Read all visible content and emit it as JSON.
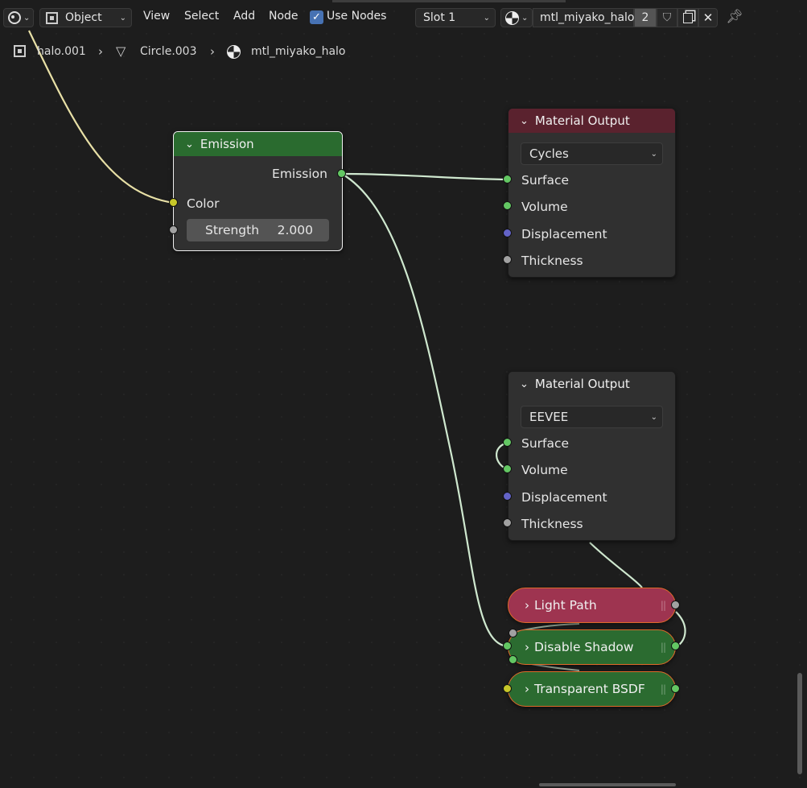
{
  "header": {
    "mode": "Object",
    "menus": [
      "View",
      "Select",
      "Add",
      "Node"
    ],
    "use_nodes_label": "Use Nodes",
    "use_nodes_checked": true,
    "slot": "Slot 1",
    "material_name": "mtl_miyako_halo",
    "user_count": "2",
    "icons": [
      "editor-type-icon",
      "object-mode-icon",
      "material-sphere-icon",
      "fake-user-shield-icon",
      "duplicate-icon",
      "close-icon",
      "pin-icon"
    ]
  },
  "breadcrumb": {
    "object": "halo.001",
    "mesh": "Circle.003",
    "material": "mtl_miyako_halo"
  },
  "nodes": {
    "emission": {
      "title": "Emission",
      "output": "Emission",
      "input_color": "Color",
      "strength_label": "Strength",
      "strength_value": "2.000"
    },
    "output_cycles": {
      "title": "Material Output",
      "target": "Cycles",
      "inputs": [
        "Surface",
        "Volume",
        "Displacement",
        "Thickness"
      ]
    },
    "output_eevee": {
      "title": "Material Output",
      "target": "EEVEE",
      "inputs": [
        "Surface",
        "Volume",
        "Displacement",
        "Thickness"
      ]
    },
    "light_path": {
      "title": "Light Path"
    },
    "disable_shadow": {
      "title": "Disable Shadow"
    },
    "transparent_bsdf": {
      "title": "Transparent BSDF"
    }
  },
  "colors": {
    "socket_shader": "#63c763",
    "socket_color": "#c7c729",
    "socket_float": "#a1a1a1",
    "socket_vector": "#6363c7",
    "link": "#cfe8cf",
    "link_color": "#e8e0a6"
  }
}
